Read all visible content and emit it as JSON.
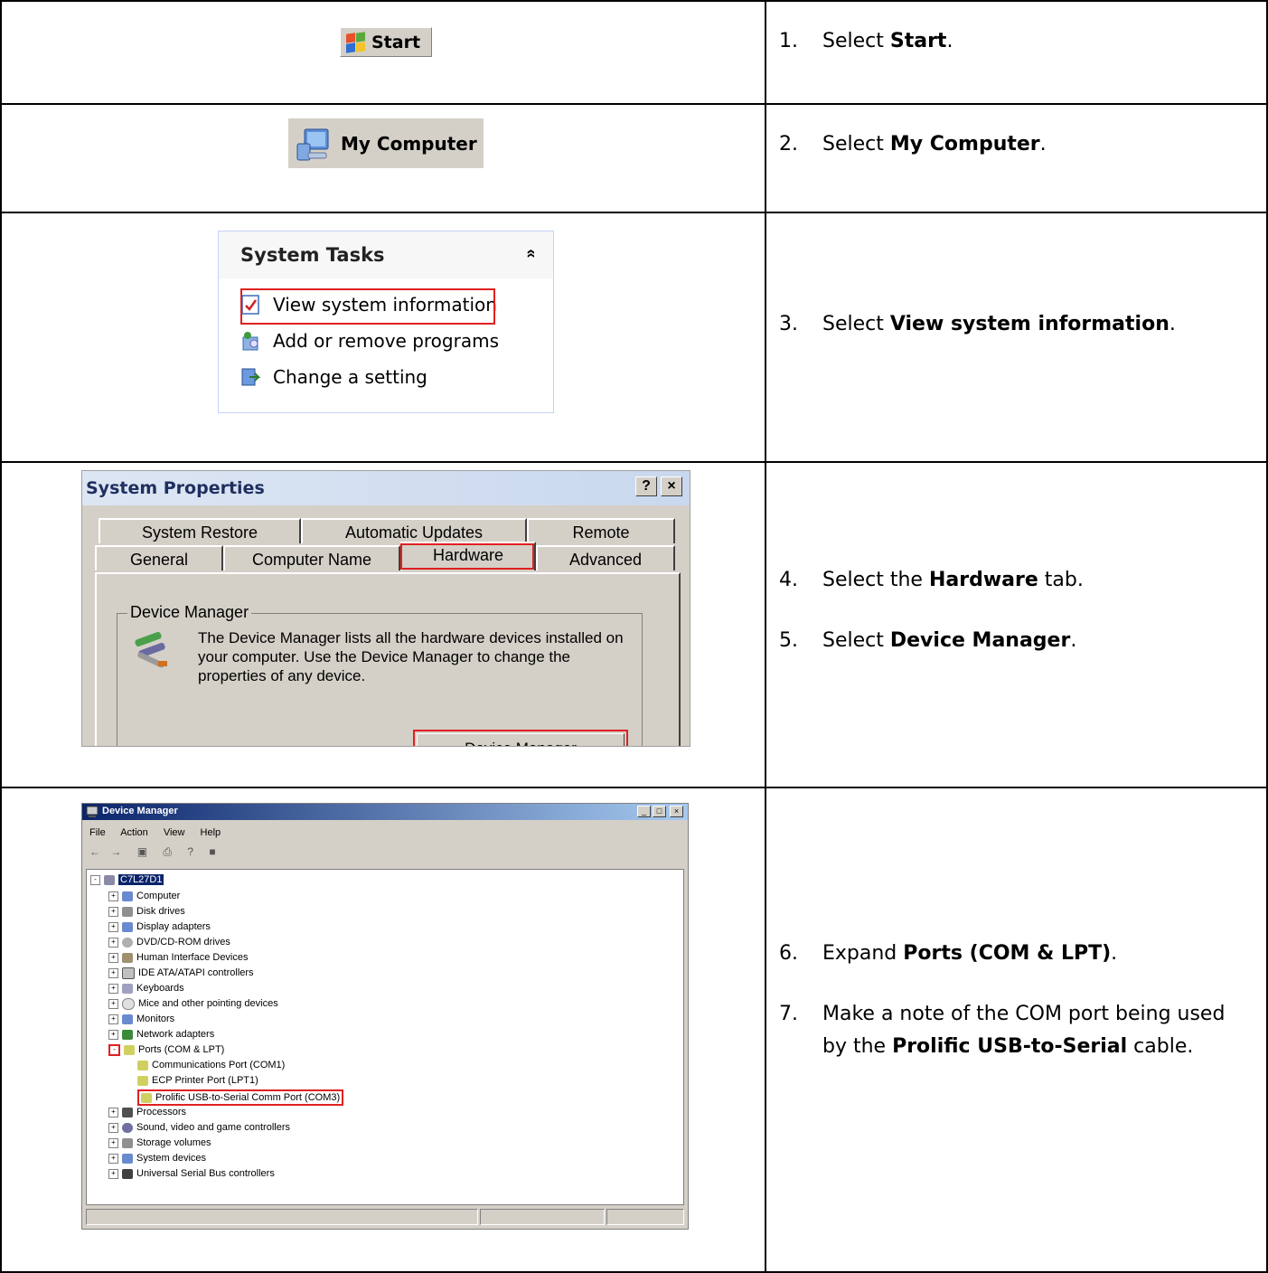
{
  "steps": [
    {
      "num": "1.",
      "pre": "Select ",
      "bold": "Start",
      "post": "."
    },
    {
      "num": "2.",
      "pre": "Select ",
      "bold": "My Computer",
      "post": "."
    },
    {
      "num": "3.",
      "pre": "Select ",
      "bold": "View system information",
      "post": "."
    },
    {
      "num": "4.",
      "pre": "Select the ",
      "bold": "Hardware",
      "post": " tab."
    },
    {
      "num": "5.",
      "pre": "Select ",
      "bold": "Device Manager",
      "post": "."
    },
    {
      "num": "6.",
      "pre": "Expand ",
      "bold": "Ports (COM & LPT)",
      "post": "."
    },
    {
      "num": "7.",
      "pre": "Make a note of the COM port being used by the ",
      "bold": "Prolific USB-to-Serial",
      "post": " cable."
    }
  ],
  "start_button": {
    "label": "Start"
  },
  "my_computer": {
    "label": "My Computer"
  },
  "system_tasks": {
    "title": "System Tasks",
    "collapse_glyph": "»",
    "items": [
      "View system information",
      "Add or remove programs",
      "Change a setting"
    ]
  },
  "system_properties": {
    "title": "System Properties",
    "help_glyph": "?",
    "close_glyph": "×",
    "tabs_back": [
      "System Restore",
      "Automatic Updates",
      "Remote"
    ],
    "tabs_front": [
      "General",
      "Computer Name",
      "Hardware",
      "Advanced"
    ],
    "group_label": "Device Manager",
    "description": "The Device Manager lists all the hardware devices installed on your computer. Use the Device Manager to change the properties of any device.",
    "button": "Device Manager"
  },
  "device_manager": {
    "title": "Device Manager",
    "menu": [
      "File",
      "Action",
      "View",
      "Help"
    ],
    "toolbar": [
      "←",
      "→",
      "▣",
      "⎙",
      "?",
      "■"
    ],
    "root": "C7L27D1",
    "categories": [
      "Computer",
      "Disk drives",
      "Display adapters",
      "DVD/CD-ROM drives",
      "Human Interface Devices",
      "IDE ATA/ATAPI controllers",
      "Keyboards",
      "Mice and other pointing devices",
      "Monitors",
      "Network adapters",
      "Ports (COM & LPT)"
    ],
    "ports": [
      "Communications Port (COM1)",
      "ECP Printer Port (LPT1)",
      "Prolific USB-to-Serial Comm Port (COM3)"
    ],
    "categories_after": [
      "Processors",
      "Sound, video and game controllers",
      "Storage volumes",
      "System devices",
      "Universal Serial Bus controllers"
    ]
  },
  "colors": {
    "highlight": "#e02020",
    "border": "#000000",
    "dialog": "#d4d0c8"
  }
}
